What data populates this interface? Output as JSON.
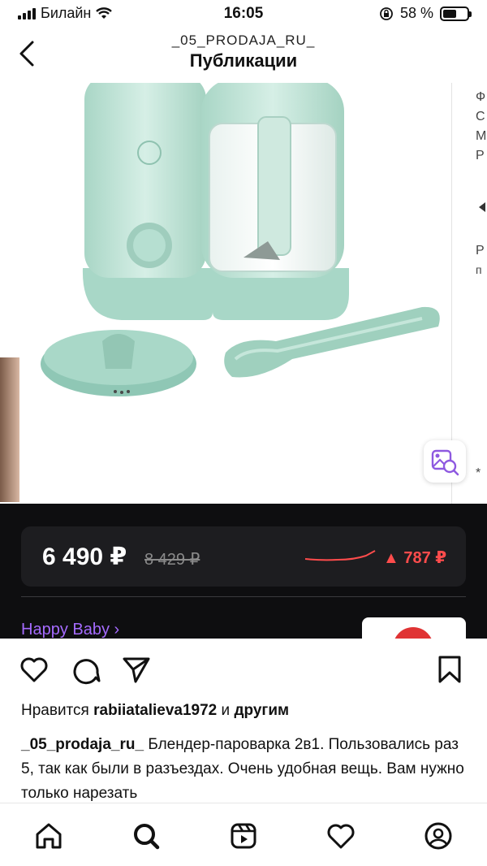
{
  "status_bar": {
    "carrier": "Билайн",
    "time": "16:05",
    "battery": "58 %",
    "battery_level": 0.58
  },
  "header": {
    "account": "_05_PRODAJA_RU_",
    "title": "Публикации"
  },
  "post_image": {
    "price_now": "6 490 ₽",
    "price_old": "8 429 ₽",
    "price_change": "▲ 787 ₽",
    "brand": "Happy Baby ›",
    "product_logo": "hb",
    "side_text_top": [
      "Ф",
      "С",
      "М",
      "Р"
    ],
    "side_text_mid": "Р",
    "side_text_mid2": "п",
    "side_text_bottom": "*"
  },
  "actions": {
    "like_icon": "heart-icon",
    "comment_icon": "comment-icon",
    "share_icon": "send-icon",
    "save_icon": "bookmark-icon"
  },
  "likes": {
    "prefix": "Нравится",
    "user": "rabiiatalieva1972",
    "joiner": "и",
    "others": "другим"
  },
  "caption": {
    "username": "_05_prodaja_ru_",
    "text": "Блендер-пароварка 2в1. Пользовались раз 5, так как были в разъездах. Очень удобная вещь. Вам нужно только нарезать"
  },
  "tabbar": [
    "home-icon",
    "search-icon",
    "reels-icon",
    "activity-icon",
    "profile-icon"
  ],
  "colors": {
    "accent_purple": "#a56bff",
    "price_red": "#ff4c4c",
    "product_mint": "#bfe3d6"
  }
}
